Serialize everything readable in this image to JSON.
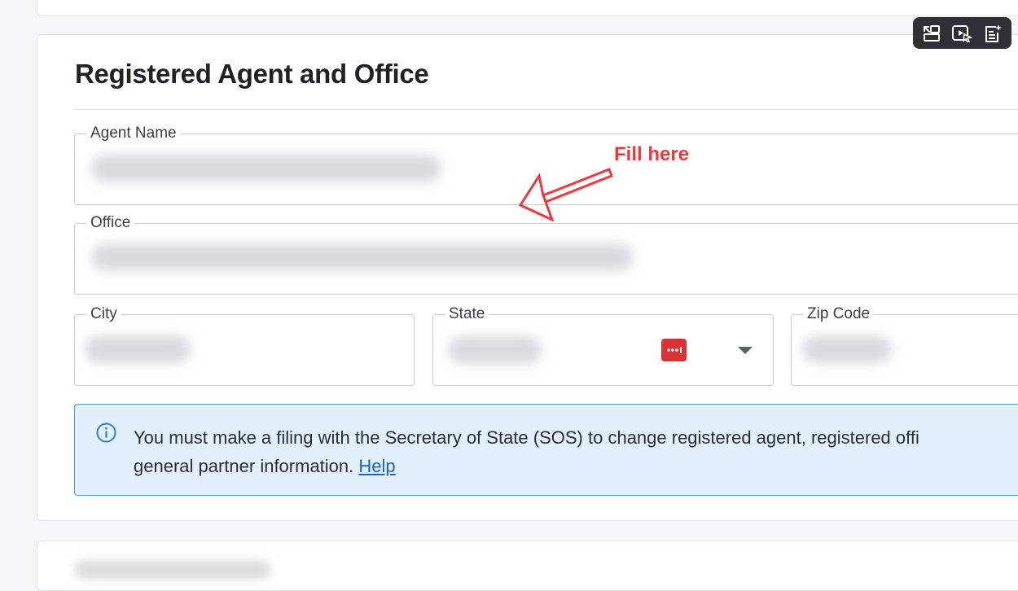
{
  "section": {
    "title": "Registered Agent and Office"
  },
  "fields": {
    "agent_name": {
      "label": "Agent Name"
    },
    "office": {
      "label": "Office"
    },
    "city": {
      "label": "City"
    },
    "state": {
      "label": "State"
    },
    "zip": {
      "label": "Zip Code"
    }
  },
  "info": {
    "line1": "You must make a filing with the Secretary of State (SOS) to change registered agent, registered offi",
    "line2": "general partner information.",
    "help_label": "Help"
  },
  "annotation": {
    "label": "Fill here",
    "color": "#e83a3f"
  },
  "toolbar": {
    "icons": [
      "swap-icon",
      "video-cursor-icon",
      "notes-sparkle-icon"
    ]
  },
  "colors": {
    "info_background": "#e3effd",
    "info_border": "#4d9be0",
    "link": "#1a62c9",
    "badge": "#d93338"
  }
}
